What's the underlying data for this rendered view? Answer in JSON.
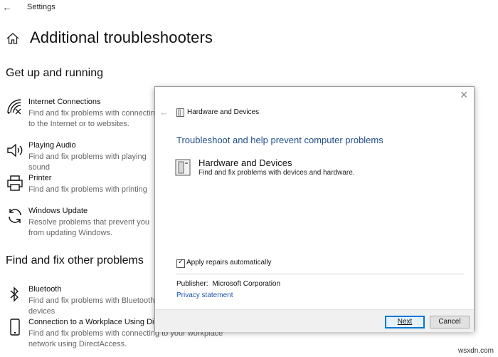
{
  "app": {
    "title": "Settings",
    "page_title": "Additional troubleshooters"
  },
  "sections": [
    {
      "title": "Get up and running"
    },
    {
      "title": "Find and fix other problems"
    }
  ],
  "items": [
    {
      "name": "Internet Connections",
      "desc": "Find and fix problems with connecting to the Internet or to websites.",
      "icon": "wifi-icon"
    },
    {
      "name": "Playing Audio",
      "desc": "Find and fix problems with playing sound",
      "icon": "speaker-icon"
    },
    {
      "name": "Printer",
      "desc": "Find and fix problems with printing",
      "icon": "printer-icon"
    },
    {
      "name": "Windows Update",
      "desc": "Resolve problems that prevent you from updating Windows.",
      "icon": "refresh-icon"
    },
    {
      "name": "Bluetooth",
      "desc": "Find and fix problems with Bluetooth devices",
      "icon": "bluetooth-icon"
    },
    {
      "name": "Connection to a Workplace Using DirectAccess",
      "desc": "Find and fix problems with connecting to your workplace network using DirectAccess.",
      "icon": "phone-icon"
    }
  ],
  "dialog": {
    "nav_title": "Hardware and Devices",
    "heading": "Troubleshoot and help prevent computer problems",
    "option_title": "Hardware and Devices",
    "option_desc": "Find and fix problems with devices and hardware.",
    "apply_label": "Apply repairs automatically",
    "apply_checked": true,
    "publisher_label": "Publisher:",
    "publisher_value": "Microsoft Corporation",
    "privacy_link": "Privacy statement",
    "next_label": "Next",
    "cancel_label": "Cancel"
  },
  "watermark": "wsxdn.com",
  "colors": {
    "link": "#1a56b3",
    "heading": "#1e4e8c",
    "accent": "#0078d7"
  }
}
